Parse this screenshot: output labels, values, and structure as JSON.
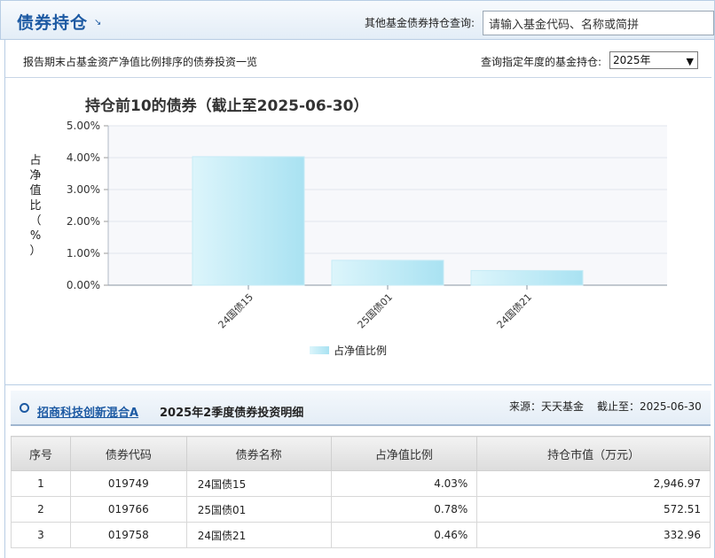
{
  "header": {
    "title": "债券持仓",
    "search_label": "其他基金债券持仓查询:",
    "search_placeholder": "请输入基金代码、名称或简拼"
  },
  "subbar": {
    "description": "报告期末占基金资产净值比例排序的债券投资一览",
    "year_label": "查询指定年度的基金持仓:",
    "year_value": "2025年"
  },
  "chart_data": {
    "type": "bar",
    "title": "持仓前10的债券（截止至2025-06-30）",
    "ylabel": "占净值比（%）",
    "categories": [
      "24国债15",
      "25国债01",
      "24国债21"
    ],
    "series": [
      {
        "name": "占净值比例",
        "values": [
          4.03,
          0.78,
          0.46
        ]
      }
    ],
    "ylim": [
      0,
      5
    ],
    "yticks": [
      "0.00%",
      "1.00%",
      "2.00%",
      "3.00%",
      "4.00%",
      "5.00%"
    ],
    "grid": true,
    "legend": "bottom",
    "bar_color": "#bfe9f5"
  },
  "detail": {
    "fund_name": "招商科技创新混合A",
    "title": "2025年2季度债券投资明细",
    "source": "来源：天天基金",
    "as_of": "截止至：2025-06-30"
  },
  "table": {
    "headers": [
      "序号",
      "债券代码",
      "债券名称",
      "占净值比例",
      "持仓市值（万元）"
    ],
    "rows": [
      [
        "1",
        "019749",
        "24国债15",
        "4.03%",
        "2,946.97"
      ],
      [
        "2",
        "019766",
        "25国债01",
        "0.78%",
        "572.51"
      ],
      [
        "3",
        "019758",
        "24国债21",
        "0.46%",
        "332.96"
      ]
    ]
  }
}
